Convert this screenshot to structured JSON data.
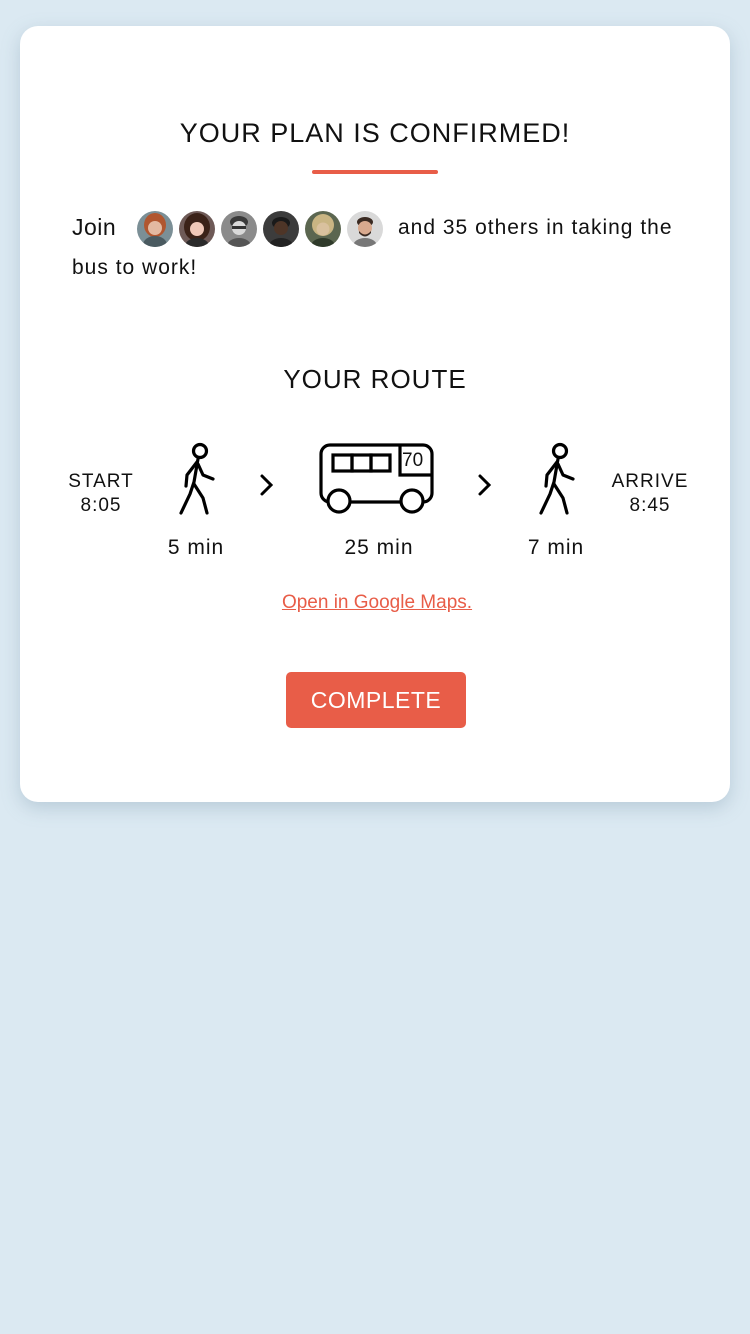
{
  "header": {
    "title": "YOUR PLAN IS CONFIRMED!"
  },
  "community": {
    "join_label": "Join",
    "after_text": "and 35 others in taking the",
    "line2_text": "bus to work!",
    "avatars": [
      {
        "name": "avatar-1",
        "bg": "#7b8f96",
        "skin": "#e3b9a1",
        "hair": "#b1562f"
      },
      {
        "name": "avatar-2",
        "bg": "#6e5a57",
        "skin": "#f0c8b8",
        "hair": "#3b2218"
      },
      {
        "name": "avatar-3",
        "bg": "#8b8b8b",
        "skin": "#d9d9d9",
        "hair": "#3a3a3a"
      },
      {
        "name": "avatar-4",
        "bg": "#3c3c3c",
        "skin": "#4e3527",
        "hair": "#1a1a1a"
      },
      {
        "name": "avatar-5",
        "bg": "#5b6650",
        "skin": "#d9c19e",
        "hair": "#c9b583"
      },
      {
        "name": "avatar-6",
        "bg": "#d9d9d9",
        "skin": "#d8a98e",
        "hair": "#3a2a22"
      }
    ]
  },
  "route": {
    "title": "YOUR ROUTE",
    "start": {
      "label": "START",
      "time": "8:05"
    },
    "arrive": {
      "label": "ARRIVE",
      "time": "8:45"
    },
    "legs": [
      {
        "icon": "walk-icon",
        "duration": "5 min"
      },
      {
        "icon": "bus-icon",
        "duration": "25 min",
        "bus_number": "70"
      },
      {
        "icon": "walk-icon",
        "duration": "7 min"
      }
    ],
    "maps_link": "Open in Google Maps."
  },
  "actions": {
    "complete_label": "COMPLETE"
  },
  "colors": {
    "accent": "#e85d48",
    "background": "#dbe9f2",
    "card": "#ffffff"
  }
}
